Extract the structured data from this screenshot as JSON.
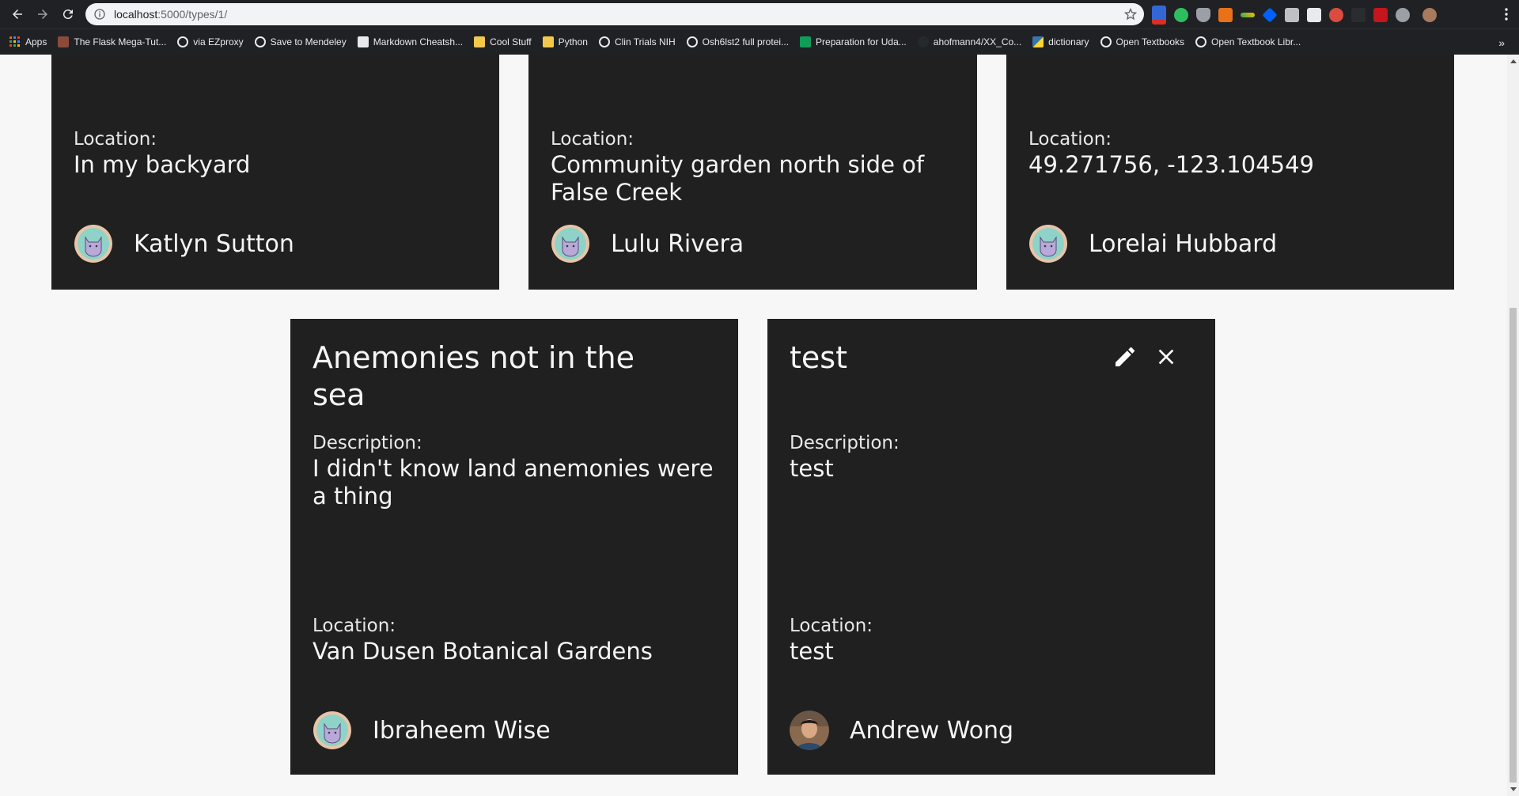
{
  "browser": {
    "url_host": "localhost",
    "url_path": ":5000/types/1/",
    "bookmarks": [
      {
        "label": "Apps",
        "icon": "apps-grid-icon"
      },
      {
        "label": "The Flask Mega-Tut...",
        "icon": "flask-tutorial-favicon"
      },
      {
        "label": "via EZproxy",
        "icon": "globe-icon"
      },
      {
        "label": "Save to Mendeley",
        "icon": "globe-icon"
      },
      {
        "label": "Markdown Cheatsh...",
        "icon": "markdown-icon"
      },
      {
        "label": "Cool Stuff",
        "icon": "folder-icon"
      },
      {
        "label": "Python",
        "icon": "folder-icon"
      },
      {
        "label": "Clin Trials NIH",
        "icon": "globe-icon"
      },
      {
        "label": "Osh6lst2 full protei...",
        "icon": "globe-icon"
      },
      {
        "label": "Preparation for Uda...",
        "icon": "sheets-icon"
      },
      {
        "label": "ahofmann4/XX_Co...",
        "icon": "github-icon"
      },
      {
        "label": "dictionary",
        "icon": "python-icon"
      },
      {
        "label": "Open Textbooks",
        "icon": "globe-icon"
      },
      {
        "label": "Open Textbook Libr...",
        "icon": "globe-icon"
      }
    ],
    "overflow_label": "»",
    "colors": {
      "chrome": "#202124",
      "omnibox": "#f1f3f4"
    }
  },
  "cards_top": [
    {
      "location_label": "Location:",
      "location": "In my backyard",
      "author": "Katlyn Sutton",
      "avatar": "cat-avatar-icon"
    },
    {
      "location_label": "Location:",
      "location": "Community garden north side of False Creek",
      "author": "Lulu Rivera",
      "avatar": "cat-avatar-icon"
    },
    {
      "location_label": "Location:",
      "location": "49.271756, -123.104549",
      "author": "Lorelai Hubbard",
      "avatar": "cat-avatar-icon"
    }
  ],
  "cards_bottom": [
    {
      "title": "Anemonies not in the sea",
      "description_label": "Description:",
      "description": "I didn't know land anemonies were a thing",
      "location_label": "Location:",
      "location": "Van Dusen Botanical Gardens",
      "author": "Ibraheem Wise",
      "avatar": "cat-avatar-icon"
    },
    {
      "title": "test",
      "description_label": "Description:",
      "description": "test",
      "location_label": "Location:",
      "location": "test",
      "author": "Andrew Wong",
      "avatar": "user-photo-avatar",
      "actions": [
        "edit-icon",
        "close-icon"
      ]
    }
  ],
  "colors": {
    "card_bg": "#202020",
    "page_bg": "#f7f7f7",
    "avatar_ring": "#e8c4a8",
    "avatar_fill": "#8fd3c8"
  }
}
